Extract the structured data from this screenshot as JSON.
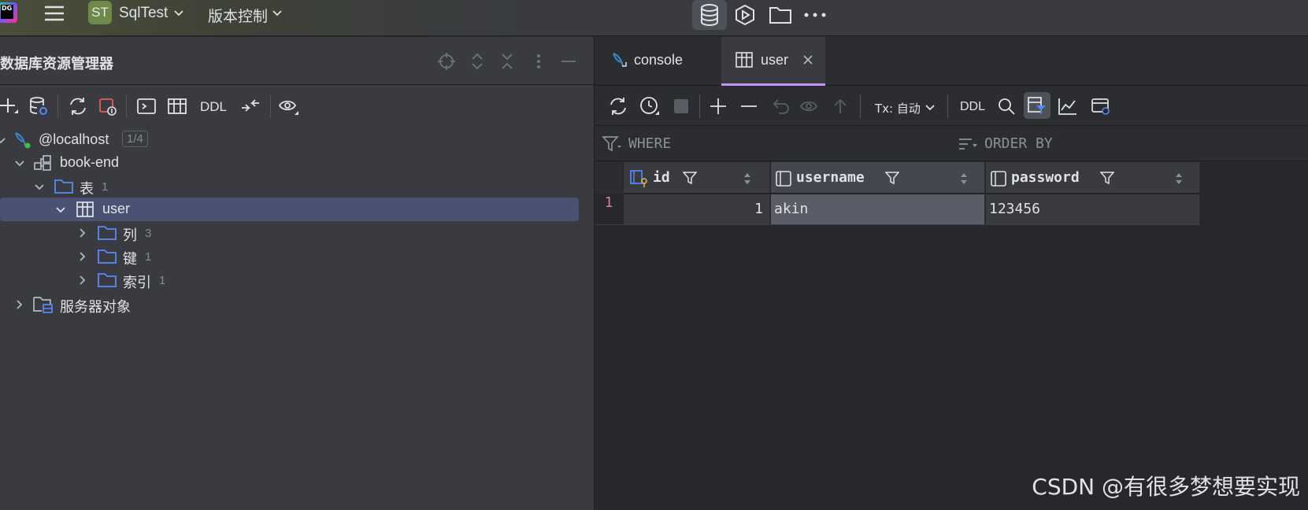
{
  "titlebar": {
    "logo_text": "DG",
    "project_badge": "ST",
    "project_name": "SqlTest",
    "vcs_label": "版本控制",
    "icons": [
      "database-icon",
      "run-services-icon",
      "folder-icon",
      "more-icon"
    ]
  },
  "left_panel": {
    "title": "数据库资源管理器",
    "toolbar": {
      "ddl_label": "DDL"
    },
    "tree": [
      {
        "label": "@localhost",
        "count": "1/4",
        "icon": "datasource-icon"
      },
      {
        "label": "book-end",
        "icon": "schema-icon"
      },
      {
        "label": "表",
        "count": "1",
        "icon": "folder-icon"
      },
      {
        "label": "user",
        "icon": "table-icon"
      },
      {
        "label": "列",
        "count": "3",
        "icon": "folder-icon"
      },
      {
        "label": "键",
        "count": "1",
        "icon": "folder-icon"
      },
      {
        "label": "索引",
        "count": "1",
        "icon": "folder-icon"
      },
      {
        "label": "服务器对象",
        "icon": "server-objects-icon"
      }
    ]
  },
  "editor": {
    "tabs": [
      {
        "label": "console"
      },
      {
        "label": "user"
      }
    ],
    "toolbar": {
      "tx_label": "Tx: 自动",
      "ddl_label": "DDL"
    },
    "filter": {
      "where": "WHERE",
      "order_by": "ORDER BY"
    },
    "grid": {
      "columns": [
        "id",
        "username",
        "password"
      ],
      "rows": [
        {
          "num": "1",
          "cells": [
            "1",
            "akin",
            "123456"
          ]
        }
      ]
    }
  },
  "watermark": "CSDN @有很多梦想要实现",
  "colors": {
    "selection": "#4a5273",
    "tab_underline": "#c491f5",
    "folder_blue": "#548af7",
    "row_number": "#e07ba0"
  }
}
